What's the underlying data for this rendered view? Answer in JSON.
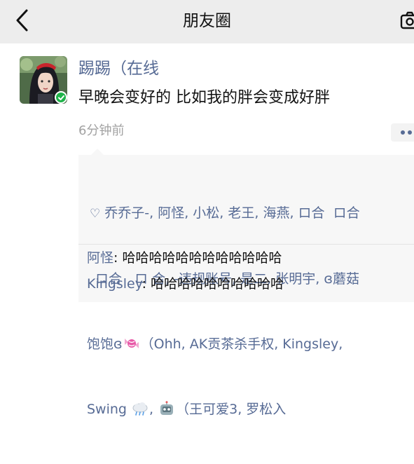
{
  "nav": {
    "title": "朋友圈"
  },
  "post": {
    "author": "踢踢（在线",
    "text": "早晚会变好的 比如我的胖会变成好胖",
    "time": "6分钟前"
  },
  "likes": {
    "line1": "乔乔子-, 阿怪, 小松, 老王, 海燕, ロ合  ロ合",
    "line2": "ロ合   ロ 合, -违规账号, 是二, 张明宇, ɞ蘑菇",
    "line3_a": "饱饱ɞ",
    "line3_b": "（Ohh, AK贡茶杀手权, Kingsley,",
    "line4_a": "Swing",
    "line4_b": ",",
    "line4_c": "（王可爱3, 罗松入"
  },
  "comments": [
    {
      "author": "阿怪",
      "separator": ": ",
      "text": "哈哈哈哈哈哈哈哈哈哈哈哈"
    },
    {
      "author": "Kingsley",
      "separator": ": ",
      "text": "哈哈哈哈哈哈哈哈哈哈"
    }
  ],
  "icons": [
    "back-icon",
    "camera-icon",
    "heart-icon",
    "more-icon",
    "candy-emoji-icon",
    "cloud-emoji-icon",
    "robot-emoji-icon"
  ],
  "colors": {
    "link": "#576b95",
    "nav_background": "#ededed",
    "comment_background": "#f7f7f7",
    "online": "#1fb34a"
  }
}
